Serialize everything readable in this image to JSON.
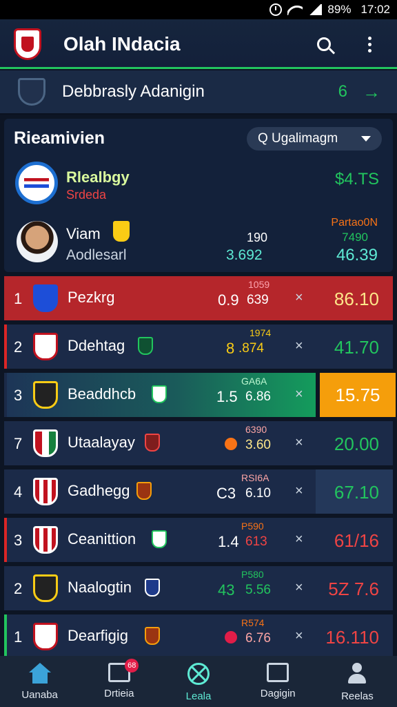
{
  "status_bar": {
    "battery": "89%",
    "time": "17:02"
  },
  "header": {
    "title": "Olah INdacia"
  },
  "banner": {
    "text": "Debbrasly Adanigin",
    "count": "6"
  },
  "recommendations": {
    "title": "Rieamivien",
    "filter_value": "Q Ugalimagm",
    "club_name": "Rlealbgy",
    "club_sub": "Srdeda",
    "club_value": "$4.TS",
    "player_name": "Viam",
    "player_role": "Aodlesarl",
    "num1": "190",
    "num2": "3.692",
    "stat_label": "Partao0N",
    "stat_1": "7490",
    "stat_2": "46.39"
  },
  "standings": [
    {
      "rank": "1",
      "team": "Pezkrg",
      "small": "1059",
      "played": "0.9",
      "gd": "639",
      "x": "×",
      "pts": "86.10"
    },
    {
      "rank": "2",
      "team": "Ddehtag",
      "small": "1974",
      "played": "8",
      "gd": ".874",
      "x": "×",
      "pts": "41.70"
    },
    {
      "rank": "3",
      "team": "Beaddhcb",
      "small": "GA6A",
      "played": "1.5",
      "gd": "6.86",
      "x": "×",
      "pts": "15.75"
    },
    {
      "rank": "7",
      "team": "Utaalayay",
      "small": "6390",
      "played": "",
      "gd": "3.60",
      "x": "×",
      "pts": "20.00"
    },
    {
      "rank": "4",
      "team": "Gadhegg",
      "small": "RSI6A",
      "played": "C3",
      "gd": "6.10",
      "x": "×",
      "pts": "67.10"
    },
    {
      "rank": "3",
      "team": "Ceanittion",
      "small": "P590",
      "played": "1.4",
      "gd": "613",
      "x": "×",
      "pts": "61/16"
    },
    {
      "rank": "2",
      "team": "Naalogtin",
      "small": "P580",
      "played": "43",
      "gd": "5.56",
      "x": "×",
      "pts": "5Z 7.6"
    },
    {
      "rank": "1",
      "team": "Dearfigig",
      "small": "R574",
      "played": "",
      "gd": "6.76",
      "x": "×",
      "pts": "16.110"
    }
  ],
  "nav": [
    {
      "label": "Uanaba"
    },
    {
      "label": "Drtieia",
      "badge": "68"
    },
    {
      "label": "Leala"
    },
    {
      "label": "Dagigin"
    },
    {
      "label": "Reelas"
    }
  ]
}
